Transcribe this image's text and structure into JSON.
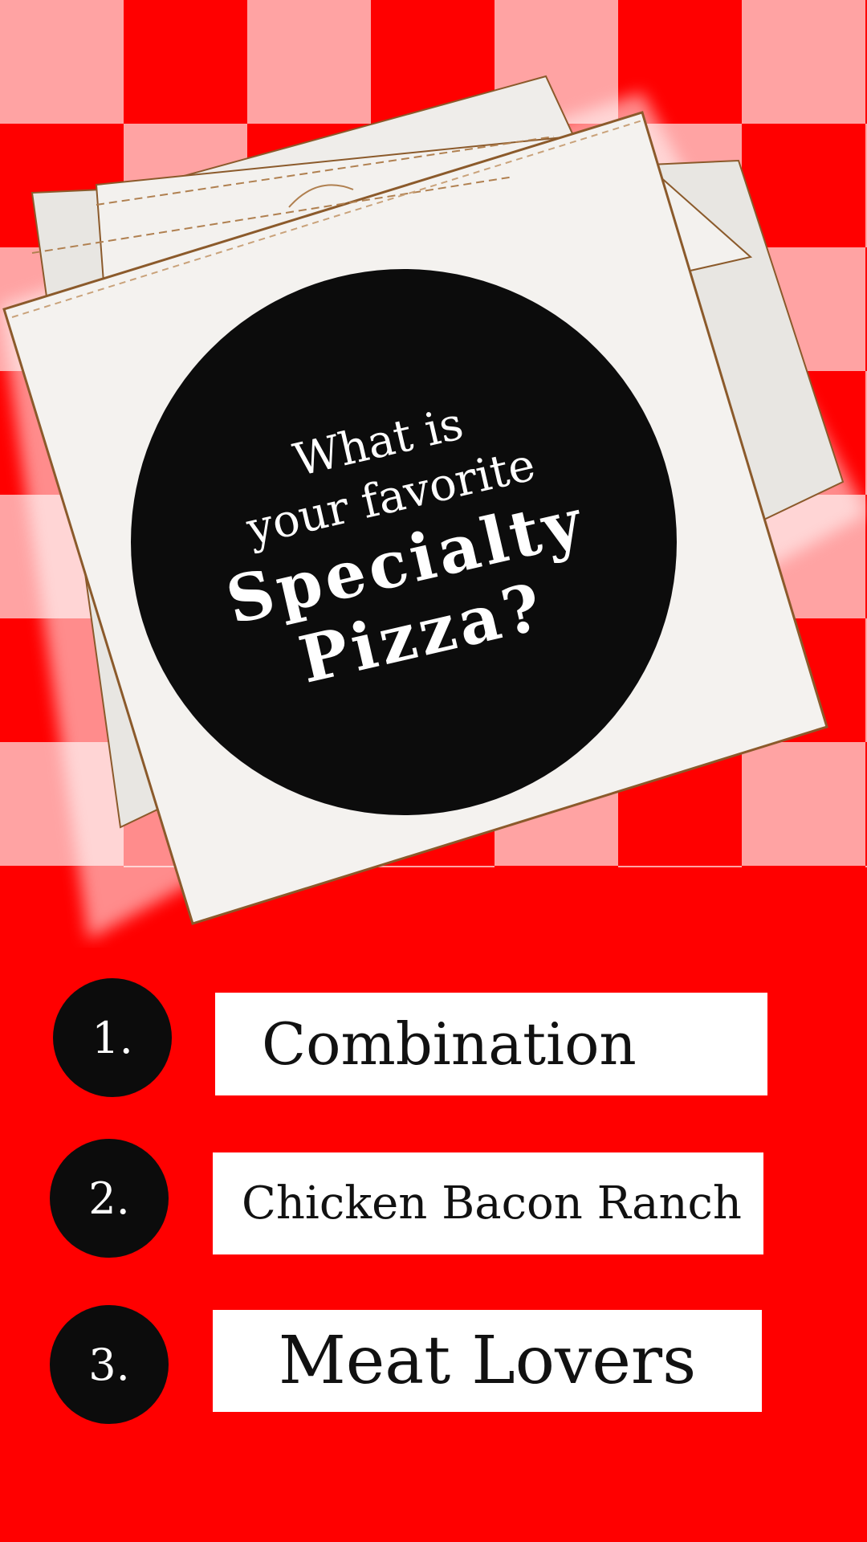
{
  "theme": {
    "background_red": "#ff0000",
    "checker_pink": "#ffa3a3",
    "circle_black": "#0c0c0c",
    "box_white": "#ffffff",
    "text_dark": "#111111"
  },
  "question": {
    "line1": "What is",
    "line2": "your favorite",
    "line3": "Specialty",
    "line4": "Pizza?"
  },
  "options": [
    {
      "number": "1.",
      "label": "Combination"
    },
    {
      "number": "2.",
      "label": "Chicken Bacon Ranch"
    },
    {
      "number": "3.",
      "label": "Meat Lovers"
    }
  ],
  "icons": {
    "illustration": "pizza-box-stack-icon"
  }
}
